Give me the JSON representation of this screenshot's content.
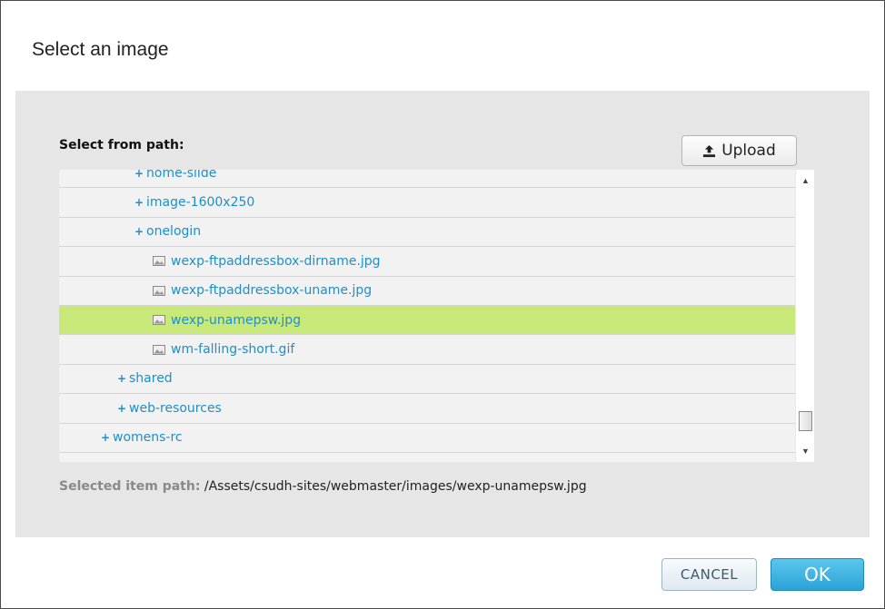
{
  "dialog": {
    "title": "Select an image"
  },
  "picker": {
    "path_label": "Select from path:",
    "upload_label": "Upload",
    "tree": [
      {
        "label": "home-slide",
        "type": "folder",
        "expander": "+",
        "indent": 3,
        "selected": false
      },
      {
        "label": "image-1600x250",
        "type": "folder",
        "expander": "+",
        "indent": 3,
        "selected": false
      },
      {
        "label": "onelogin",
        "type": "folder",
        "expander": "+",
        "indent": 3,
        "selected": false
      },
      {
        "label": "wexp-ftpaddressbox-dirname.jpg",
        "type": "file",
        "indent": 4,
        "selected": false
      },
      {
        "label": "wexp-ftpaddressbox-uname.jpg",
        "type": "file",
        "indent": 4,
        "selected": false
      },
      {
        "label": "wexp-unamepsw.jpg",
        "type": "file",
        "indent": 4,
        "selected": true
      },
      {
        "label": "wm-falling-short.gif",
        "type": "file",
        "indent": 4,
        "selected": false
      },
      {
        "label": "shared",
        "type": "folder",
        "expander": "+",
        "indent": 2,
        "selected": false
      },
      {
        "label": "web-resources",
        "type": "folder",
        "expander": "+",
        "indent": 2,
        "selected": false
      },
      {
        "label": "womens-rc",
        "type": "folder",
        "expander": "+",
        "indent": 1,
        "selected": false
      },
      {
        "label": "",
        "type": "folder",
        "expander": "+",
        "indent": 1,
        "selected": false
      }
    ],
    "selected_path_label": "Selected item path:",
    "selected_path_value": "/Assets/csudh-sites/webmaster/images/wexp-unamepsw.jpg"
  },
  "footer": {
    "cancel_label": "CANCEL",
    "ok_label": "OK"
  },
  "colors": {
    "link": "#1e8fc9",
    "selected_row": "#c8e87a",
    "ok_button": "#2aa3d6",
    "panel_bg": "#e6e6e6"
  }
}
